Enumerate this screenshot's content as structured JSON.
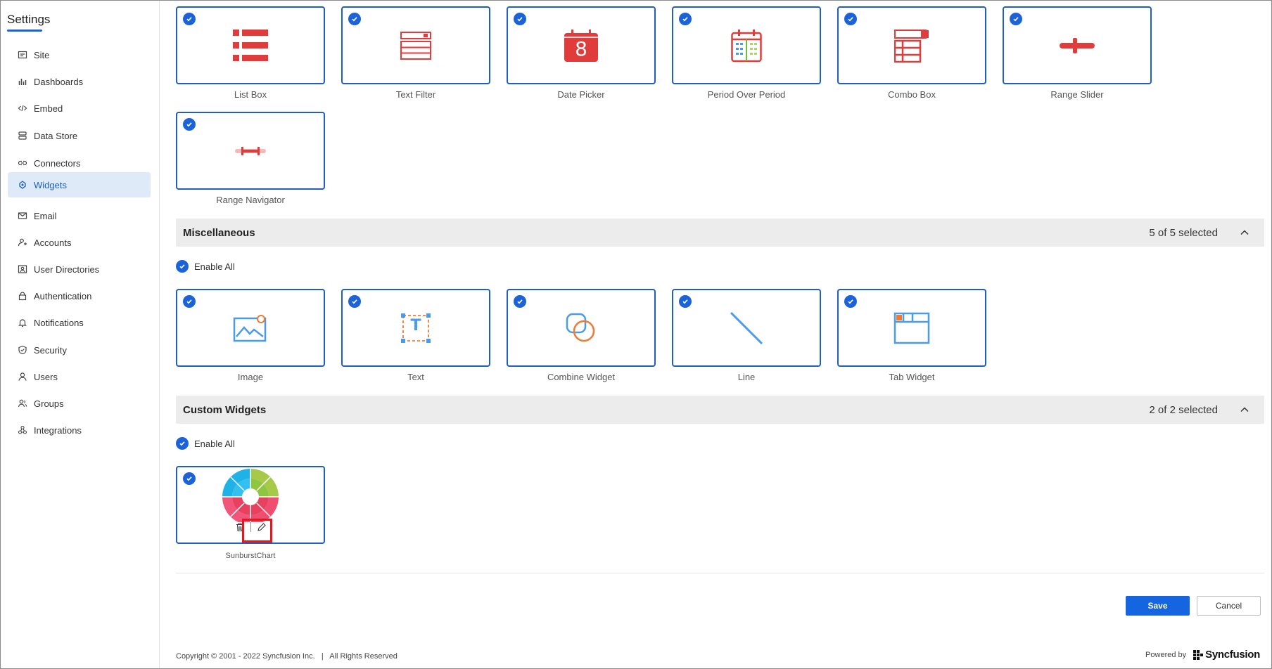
{
  "sidebar": {
    "title": "Settings",
    "items": [
      {
        "label": "Site",
        "icon": "site-icon"
      },
      {
        "label": "Dashboards",
        "icon": "dashboards-icon"
      },
      {
        "label": "Embed",
        "icon": "embed-icon"
      },
      {
        "label": "Data Store",
        "icon": "data-store-icon"
      },
      {
        "label": "Connectors",
        "icon": "connectors-icon"
      },
      {
        "label": "Widgets",
        "icon": "widgets-icon",
        "active": true
      },
      {
        "label": "Email",
        "icon": "email-icon"
      },
      {
        "label": "Accounts",
        "icon": "accounts-icon"
      },
      {
        "label": "User Directories",
        "icon": "user-directories-icon"
      },
      {
        "label": "Authentication",
        "icon": "authentication-icon"
      },
      {
        "label": "Notifications",
        "icon": "notifications-icon"
      },
      {
        "label": "Security",
        "icon": "security-icon"
      },
      {
        "label": "Users",
        "icon": "users-icon"
      },
      {
        "label": "Groups",
        "icon": "groups-icon"
      },
      {
        "label": "Integrations",
        "icon": "integrations-icon"
      }
    ]
  },
  "filters": {
    "cards": [
      {
        "label": "List Box",
        "icon": "list-box-icon"
      },
      {
        "label": "Text Filter",
        "icon": "text-filter-icon"
      },
      {
        "label": "Date Picker",
        "icon": "date-picker-icon",
        "glyph_text": "8"
      },
      {
        "label": "Period Over Period",
        "icon": "period-over-period-icon"
      },
      {
        "label": "Combo Box",
        "icon": "combo-box-icon"
      },
      {
        "label": "Range Slider",
        "icon": "range-slider-icon"
      },
      {
        "label": "Range Navigator",
        "icon": "range-navigator-icon"
      }
    ]
  },
  "miscellaneous": {
    "title": "Miscellaneous",
    "count_selected": "5",
    "count_total": "5",
    "count_text": "5 of 5 selected",
    "enable_all": "Enable All",
    "cards": [
      {
        "label": "Image",
        "icon": "image-icon"
      },
      {
        "label": "Text",
        "icon": "text-icon",
        "glyph_text": "T"
      },
      {
        "label": "Combine Widget",
        "icon": "combine-widget-icon"
      },
      {
        "label": "Line",
        "icon": "line-icon"
      },
      {
        "label": "Tab Widget",
        "icon": "tab-widget-icon"
      }
    ]
  },
  "custom_widgets": {
    "title": "Custom Widgets",
    "count_text": "2 of 2 selected",
    "enable_all": "Enable All",
    "cards": [
      {
        "label": "SunburstChart",
        "icon": "sunburst-chart-icon"
      }
    ]
  },
  "actions": {
    "save": "Save",
    "cancel": "Cancel"
  },
  "footer": {
    "copyright": "Copyright © 2001 - 2022 Syncfusion Inc.   |   All Rights Reserved",
    "powered_by": "Powered by",
    "brand": "Syncfusion"
  },
  "colors": {
    "accent": "#1c63d9",
    "card_border": "#1f5ec4",
    "widget_red": "#e03c3c",
    "misc_blue": "#4a9be8",
    "misc_orange": "#ee7a34",
    "highlight": "#e0191f"
  }
}
